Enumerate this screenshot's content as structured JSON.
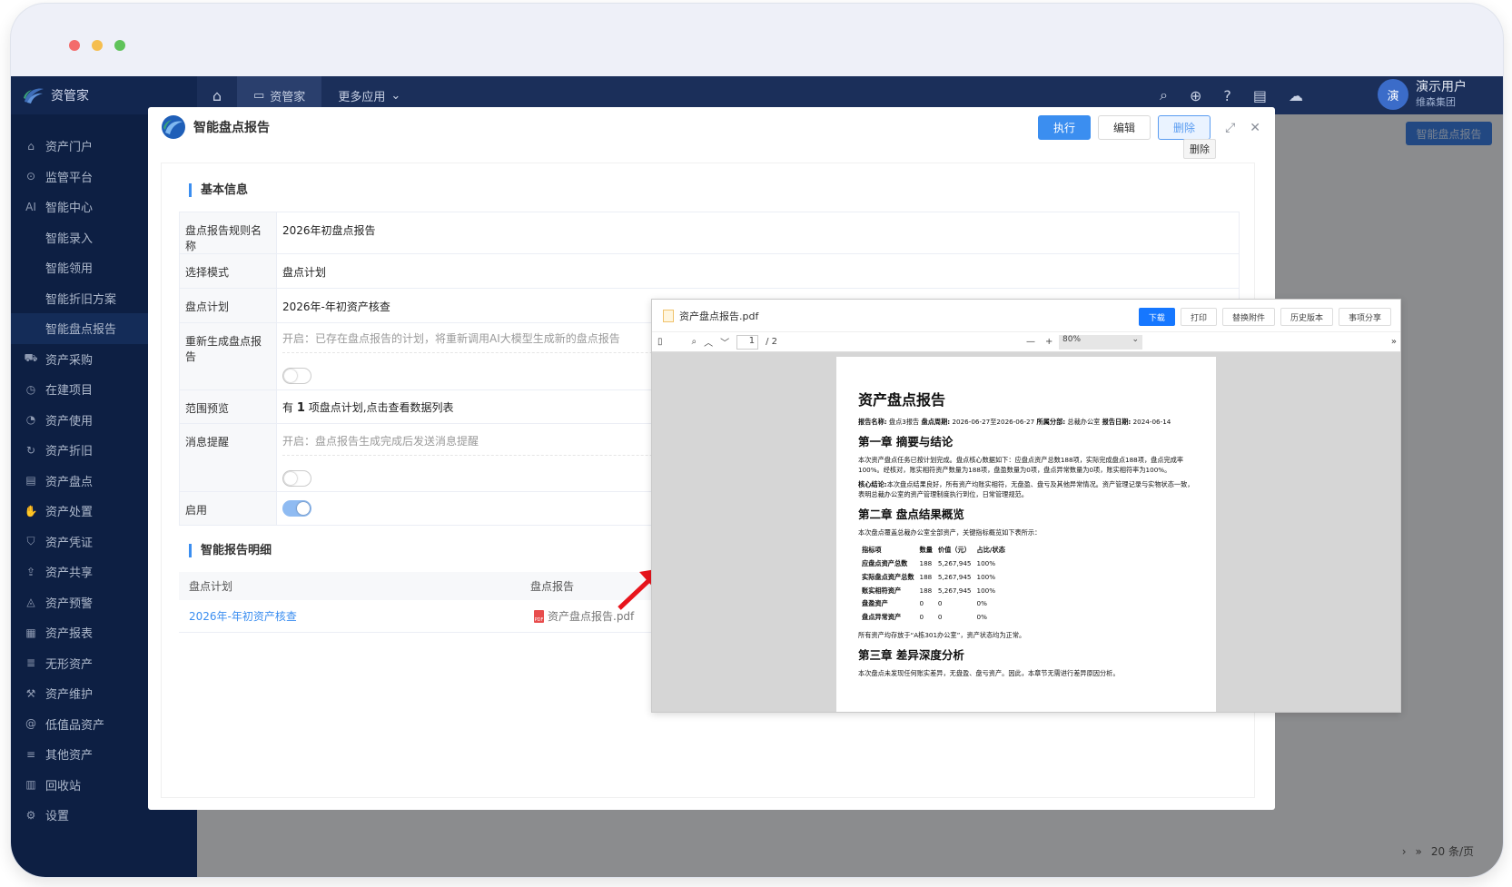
{
  "colors": {
    "dot_red": "#f36b6b",
    "dot_yellow": "#f5be4f",
    "dot_green": "#5fc35a",
    "sidebar_bg": "#0d1f43",
    "primary": "#3b8ef0",
    "annotation_arrow": "#e8141c"
  },
  "sidebar": {
    "logo": "资管家",
    "items": [
      {
        "label": "资产门户",
        "icon": "home-icon"
      },
      {
        "label": "监管平台",
        "icon": "location-icon"
      },
      {
        "label": "智能中心",
        "icon": "ai-icon"
      },
      {
        "label": "智能录入",
        "icon": ""
      },
      {
        "label": "智能领用",
        "icon": ""
      },
      {
        "label": "智能折旧方案",
        "icon": ""
      },
      {
        "label": "智能盘点报告",
        "icon": ""
      },
      {
        "label": "资产采购",
        "icon": "cart-icon"
      },
      {
        "label": "在建项目",
        "icon": "clock-icon"
      },
      {
        "label": "资产使用",
        "icon": "pie-icon"
      },
      {
        "label": "资产折旧",
        "icon": "refresh-icon"
      },
      {
        "label": "资产盘点",
        "icon": "clipboard-icon"
      },
      {
        "label": "资产处置",
        "icon": "hand-icon"
      },
      {
        "label": "资产凭证",
        "icon": "shield-icon"
      },
      {
        "label": "资产共享",
        "icon": "share-icon"
      },
      {
        "label": "资产预警",
        "icon": "bell-icon"
      },
      {
        "label": "资产报表",
        "icon": "report-icon"
      },
      {
        "label": "无形资产",
        "icon": "list-icon"
      },
      {
        "label": "资产维护",
        "icon": "wrench-icon"
      },
      {
        "label": "低值品资产",
        "icon": "at-icon"
      },
      {
        "label": "其他资产",
        "icon": "stack-icon"
      },
      {
        "label": "回收站",
        "icon": "trash-icon"
      },
      {
        "label": "设置",
        "icon": "gear-icon"
      }
    ]
  },
  "topbar": {
    "tab_active": "资管家",
    "tab_more": "更多应用",
    "avatar_char": "演",
    "user_name": "演示用户",
    "user_company": "维森集团"
  },
  "background": {
    "button": "智能盘点报告",
    "page_size": "20 条/页"
  },
  "modal": {
    "title": "智能盘点报告",
    "execute": "执行",
    "edit": "编辑",
    "delete": "删除",
    "tooltip": "删除",
    "section_basic": "基本信息",
    "rows": {
      "rule_name_label": "盘点报告规则名称",
      "rule_name_value": "2026年初盘点报告",
      "mode_label": "选择模式",
      "mode_value": "盘点计划",
      "plan_label": "盘点计划",
      "plan_value": "2026年-年初资产核查",
      "regen_label": "重新生成盘点报告",
      "regen_hint": "开启：已存在盘点报告的计划，将重新调用AI大模型生成新的盘点报告",
      "scope_label": "范围预览",
      "scope_prefix": "有",
      "scope_count": "1",
      "scope_suffix": "项盘点计划,点击查看数据列表",
      "notify_label": "消息提醒",
      "notify_hint": "开启：盘点报告生成完成后发送消息提醒",
      "enable_label": "启用"
    },
    "section_detail": "智能报告明细",
    "detail_headers": [
      "盘点计划",
      "盘点报告"
    ],
    "detail_row": {
      "plan": "2026年-年初资产核查",
      "report": "资产盘点报告.pdf"
    }
  },
  "pdf": {
    "filename": "资产盘点报告.pdf",
    "buttons": [
      "下载",
      "打印",
      "替换附件",
      "历史版本",
      "事项分享"
    ],
    "page_current": "1",
    "page_total": "/ 2",
    "zoom": "80%",
    "doc_title": "资产盘点报告",
    "meta": {
      "name_label": "报告名称:",
      "name": "盘点3报告",
      "period_label": "盘点周期:",
      "period": "2026-06-27至2026-06-27",
      "dept_label": "所属分部:",
      "dept": "总裁办公室",
      "date_label": "报告日期:",
      "date": "2024-06-14"
    },
    "ch1": "第一章 摘要与结论",
    "ch1_p1": "本次资产盘点任务已按计划完成。盘点核心数据如下：应盘点资产总数188项，实际完成盘点188项，盘点完成率100%。经核对，账实相符资产数量为188项，盘盈数量为0项，盘点异常数量为0项，账实相符率为100%。",
    "ch1_p2_label": "核心结论:",
    "ch1_p2": "本次盘点结果良好，所有资产均账实相符，无盘盈、盘亏及其他异常情况。资产管理记录与实物状态一致，表明总裁办公室的资产管理制度执行到位，日常管理规范。",
    "ch2": "第二章 盘点结果概览",
    "ch2_p1": "本次盘点覆盖总裁办公室全部资产，关键指标概览如下表所示：",
    "table_headers": [
      "指标项",
      "数量",
      "价值（元）",
      "占比/状态"
    ],
    "table_rows": [
      [
        "应盘点资产总数",
        "188",
        "5,267,945",
        "100%"
      ],
      [
        "实际盘点资产总数",
        "188",
        "5,267,945",
        "100%"
      ],
      [
        "账实相符资产",
        "188",
        "5,267,945",
        "100%"
      ],
      [
        "盘盈资产",
        "0",
        "0",
        "0%"
      ],
      [
        "盘点异常资产",
        "0",
        "0",
        "0%"
      ]
    ],
    "ch2_p2": "所有资产均存放于“A栋301办公室”，资产状态均为正常。",
    "ch3": "第三章 差异深度分析",
    "ch3_p1": "本次盘点未发现任何账实差异，无盘盈、盘亏资产。因此，本章节无需进行差异原因分析。"
  }
}
